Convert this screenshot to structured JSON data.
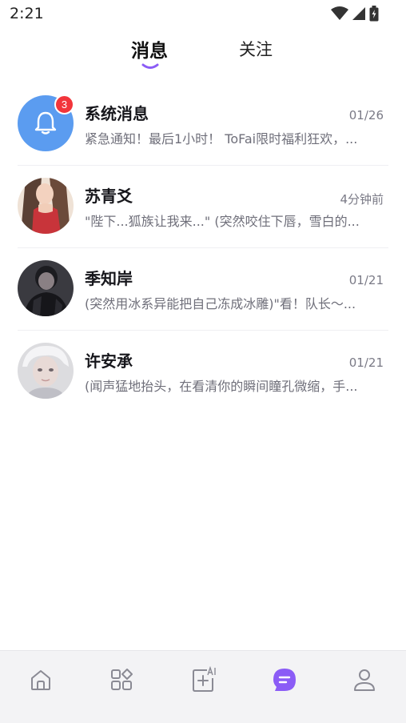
{
  "status_bar": {
    "time": "2:21"
  },
  "tabs": [
    {
      "label": "消息",
      "active": true
    },
    {
      "label": "关注",
      "active": false
    }
  ],
  "accent_color": "#8b5cf6",
  "conversations": [
    {
      "name": "系统消息",
      "time": "01/26",
      "preview": "紧急通知！最后1小时！ ToFai限时福利狂欢，...",
      "badge": "3",
      "avatar": "bell-icon"
    },
    {
      "name": "苏青爻",
      "time": "4分钟前",
      "preview": "\"陛下...狐族让我来...\" (突然咬住下唇，雪白的...",
      "avatar": "photo"
    },
    {
      "name": "季知岸",
      "time": "01/21",
      "preview": "(突然用冰系异能把自己冻成冰雕)\"看！队长～...",
      "avatar": "photo"
    },
    {
      "name": "许安承",
      "time": "01/21",
      "preview": "(闻声猛地抬头，在看清你的瞬间瞳孔微缩，手...",
      "avatar": "photo"
    }
  ],
  "bottom_nav": [
    {
      "icon": "home-icon",
      "active": false
    },
    {
      "icon": "apps-icon",
      "active": false
    },
    {
      "icon": "ai-create-icon",
      "active": false
    },
    {
      "icon": "messages-icon",
      "active": true
    },
    {
      "icon": "profile-icon",
      "active": false
    }
  ]
}
